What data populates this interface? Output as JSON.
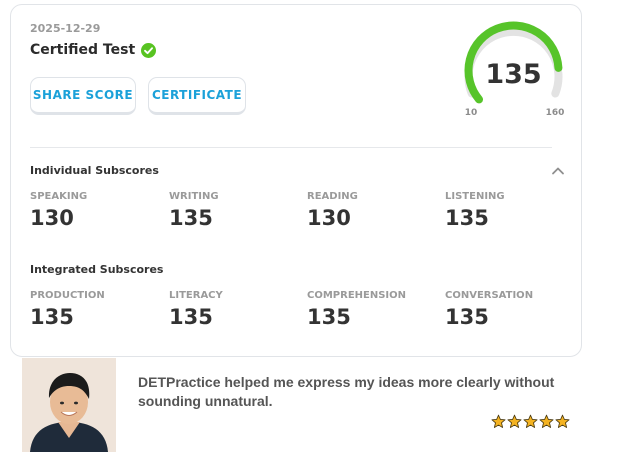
{
  "result": {
    "date": "2025-12-29",
    "title": "Certified Test",
    "verified_icon": "check-circle-icon",
    "buttons": {
      "share": "SHARE SCORE",
      "certificate": "CERTIFICATE"
    },
    "overall": {
      "score": "135",
      "min_label": "10",
      "max_label": "160",
      "min": 10,
      "max": 160,
      "value": 135
    }
  },
  "individual": {
    "title": "Individual Subscores",
    "collapse_icon": "chevron-up-icon",
    "items": [
      {
        "label": "SPEAKING",
        "value": "130"
      },
      {
        "label": "WRITING",
        "value": "135"
      },
      {
        "label": "READING",
        "value": "130"
      },
      {
        "label": "LISTENING",
        "value": "135"
      }
    ]
  },
  "integrated": {
    "title": "Integrated Subscores",
    "items": [
      {
        "label": "PRODUCTION",
        "value": "135"
      },
      {
        "label": "LITERACY",
        "value": "135"
      },
      {
        "label": "COMPREHENSION",
        "value": "135"
      },
      {
        "label": "CONVERSATION",
        "value": "135"
      }
    ]
  },
  "testimonial": {
    "quote": "DETPractice helped me express my ideas more clearly without sounding unnatural.",
    "rating": 5,
    "rating_max": 5,
    "star_icon": "star-icon"
  },
  "colors": {
    "accent": "#1ba1d9",
    "gauge_fill": "#57c42a",
    "gauge_track": "#e3e3e3",
    "verified": "#58c322",
    "star": "#f4b322"
  }
}
